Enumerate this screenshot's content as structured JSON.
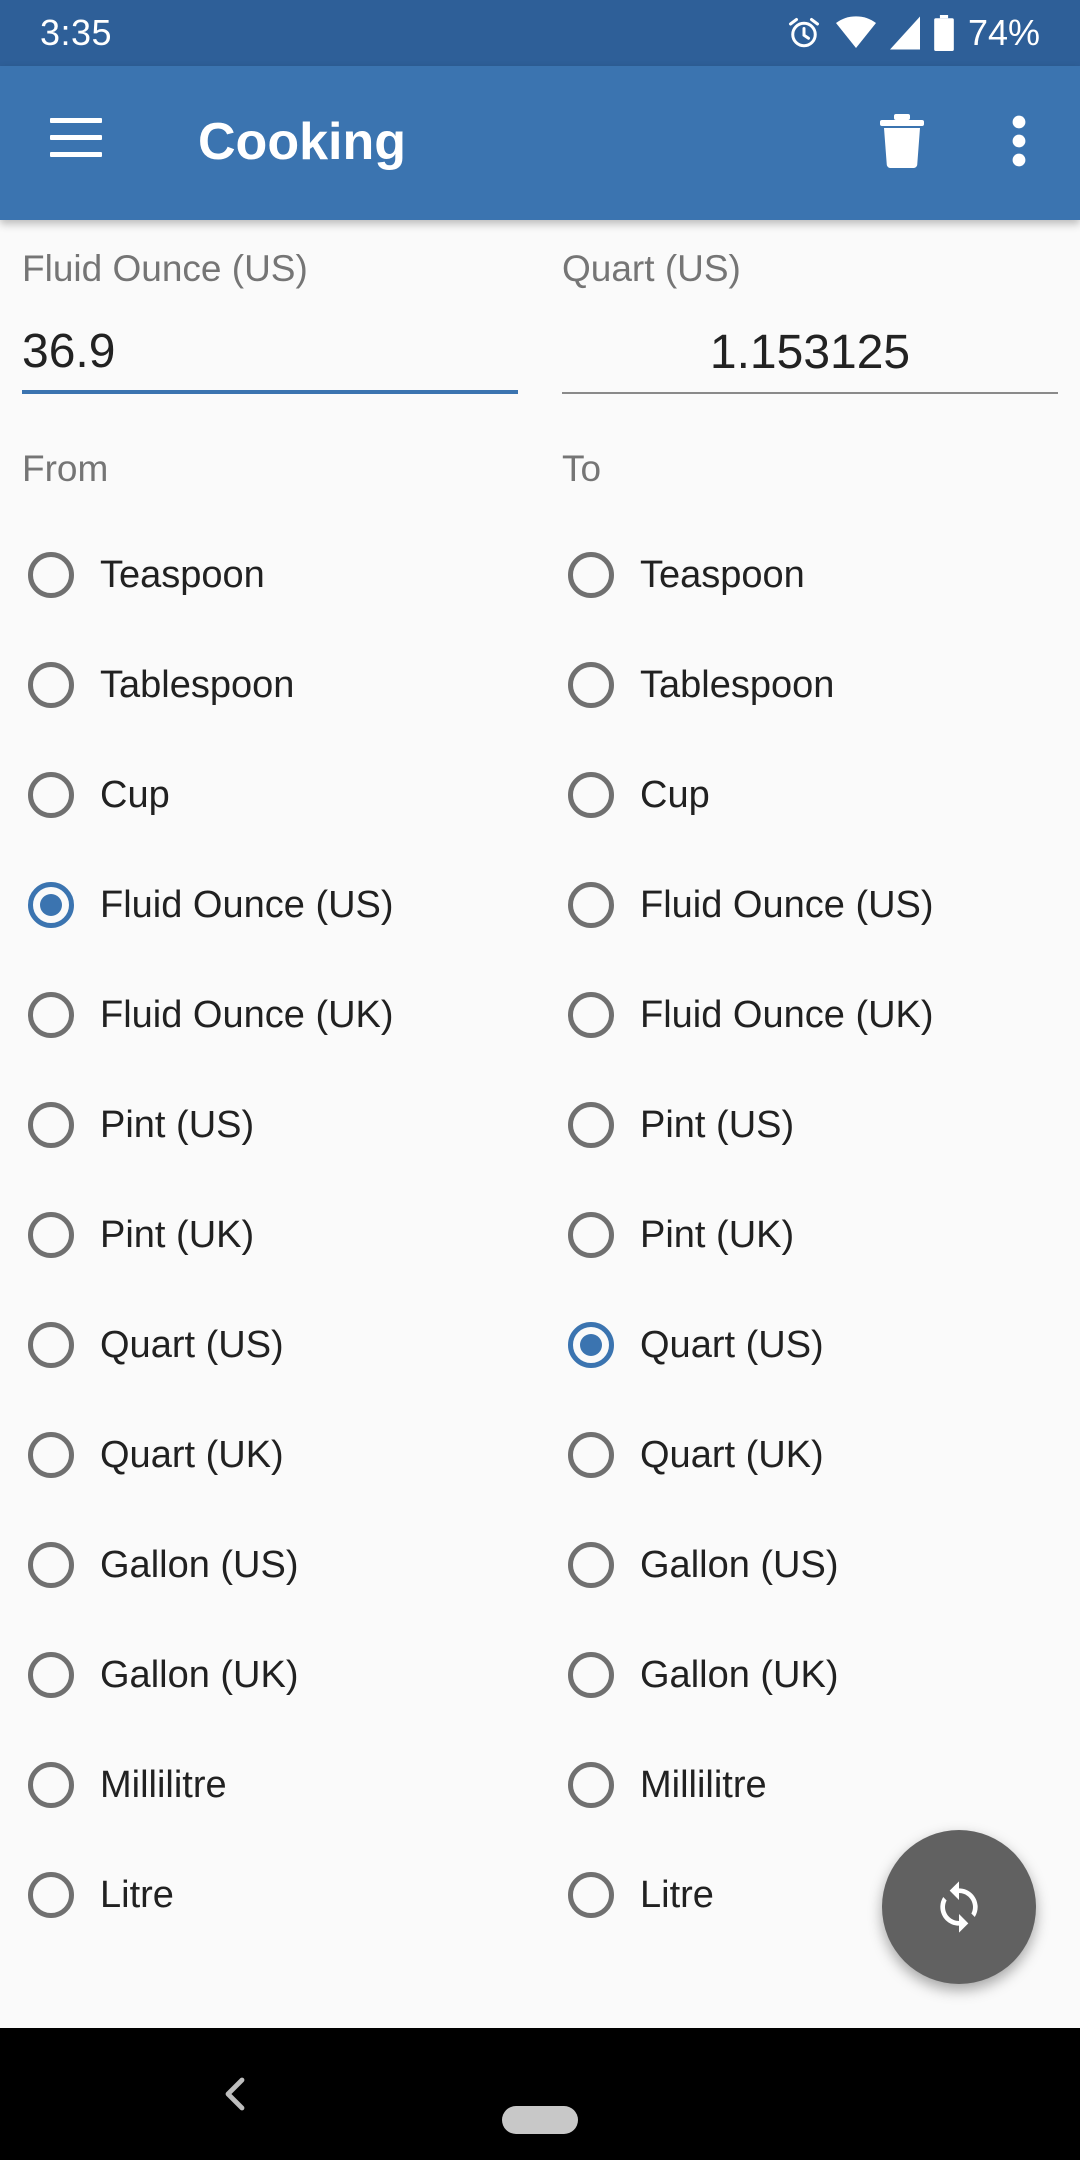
{
  "status_bar": {
    "time": "3:35",
    "battery_percent": "74%",
    "icons": [
      "alarm-icon",
      "wifi-icon",
      "signal-icon",
      "battery-icon"
    ]
  },
  "app_bar": {
    "title": "Cooking",
    "icons": [
      "menu-icon",
      "delete-icon",
      "more-vert-icon"
    ]
  },
  "from": {
    "unit_label": "Fluid Ounce (US)",
    "value": "36.9",
    "section_label": "From",
    "selected": "Fluid Ounce (US)"
  },
  "to": {
    "unit_label": "Quart (US)",
    "value": "1.153125",
    "section_label": "To",
    "selected": "Quart (US)"
  },
  "units": [
    "Teaspoon",
    "Tablespoon",
    "Cup",
    "Fluid Ounce (US)",
    "Fluid Ounce (UK)",
    "Pint (US)",
    "Pint (UK)",
    "Quart (US)",
    "Quart (UK)",
    "Gallon (US)",
    "Gallon (UK)",
    "Millilitre",
    "Litre"
  ],
  "fab": {
    "icon": "swap-icon"
  },
  "nav_bar": {
    "icons": [
      "back-icon",
      "home-pill-icon"
    ]
  },
  "colors": {
    "status_bar": "#2e5f98",
    "app_bar": "#3b74b0",
    "accent": "#3b74b0",
    "fab": "#616161"
  }
}
